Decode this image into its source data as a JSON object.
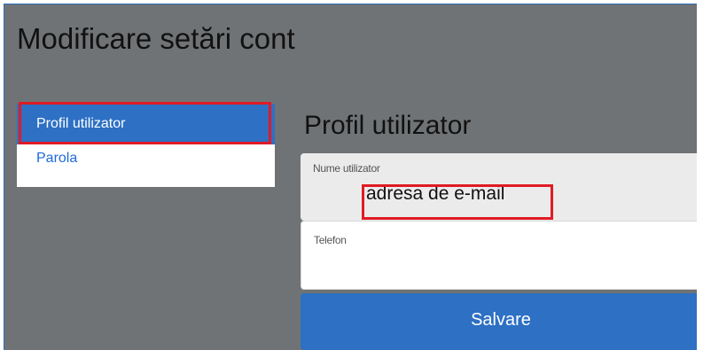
{
  "page": {
    "title": "Modificare setări cont"
  },
  "sidebar": {
    "items": [
      {
        "label": "Profil utilizator",
        "active": true
      },
      {
        "label": "Parola",
        "active": false
      }
    ]
  },
  "main": {
    "section_title": "Profil utilizator",
    "fields": {
      "username": {
        "label": "Nume utilizator",
        "value": "adresa de e-mail"
      },
      "phone": {
        "label": "Telefon",
        "value": ""
      }
    },
    "save_label": "Salvare"
  },
  "colors": {
    "background": "#707375",
    "accent": "#2d70c4",
    "link": "#1e6ad9",
    "annotation": "#e01b24"
  }
}
